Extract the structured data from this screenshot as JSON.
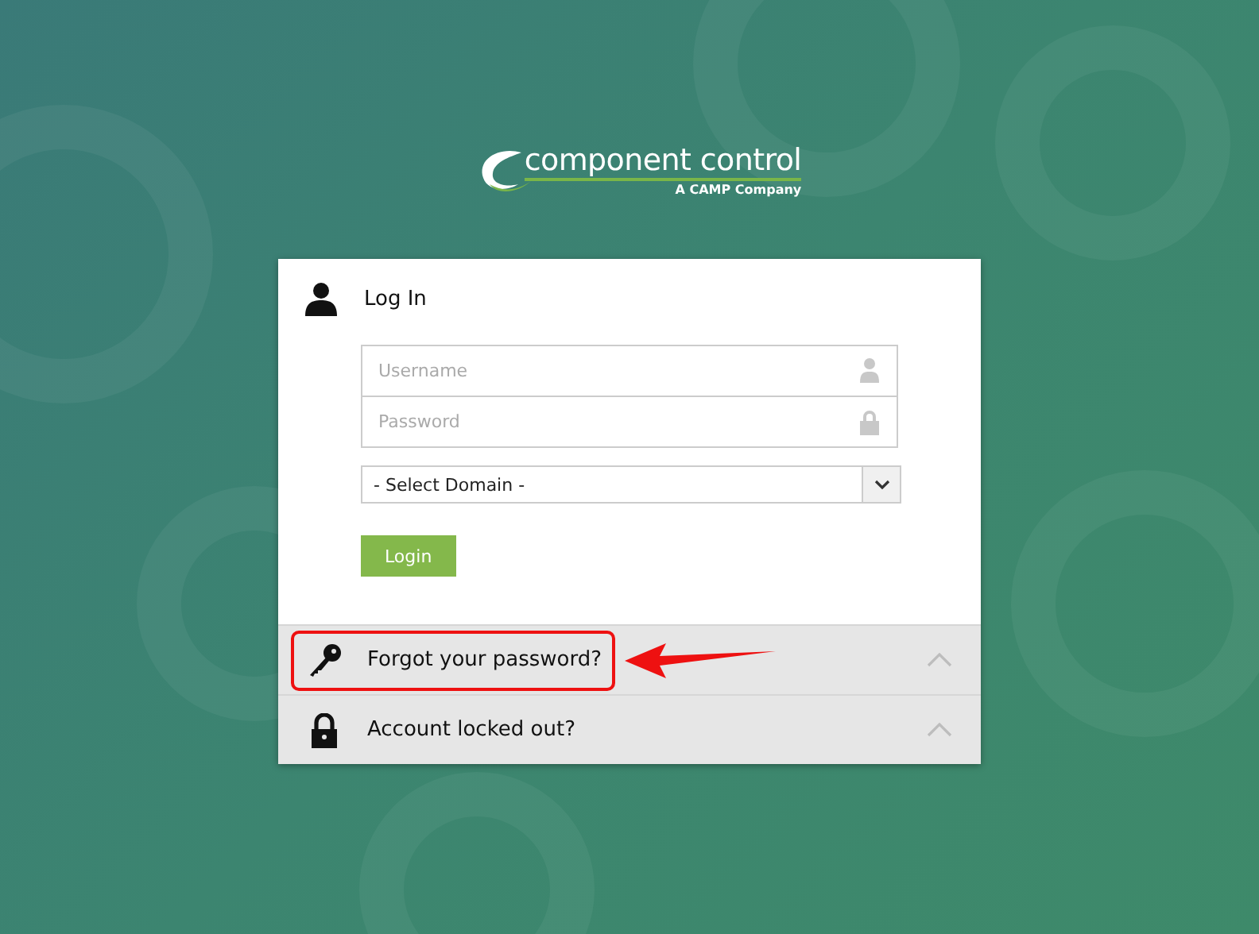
{
  "logo": {
    "name": "component control",
    "tagline": "A CAMP Company"
  },
  "login": {
    "title": "Log In",
    "username": {
      "placeholder": "Username"
    },
    "password": {
      "placeholder": "Password"
    },
    "domain": {
      "value": "- Select Domain -"
    },
    "button": "Login"
  },
  "panels": [
    {
      "kind": "key",
      "label": "Forgot your password?",
      "expanded": false,
      "highlighted": true
    },
    {
      "kind": "lock",
      "label": "Account locked out?",
      "expanded": false,
      "highlighted": false
    }
  ]
}
